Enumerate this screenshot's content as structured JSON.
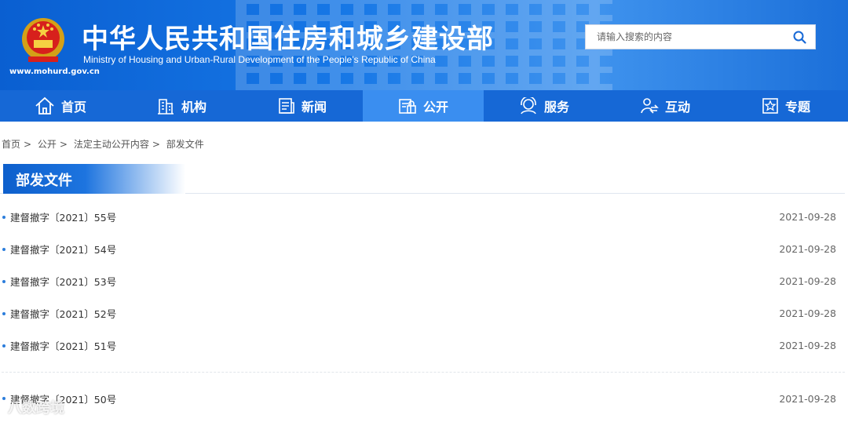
{
  "header": {
    "title_cn": "中华人民共和国住房和城乡建设部",
    "title_en": "Ministry of Housing and Urban-Rural Development of the People’s Republic of China",
    "url": "www.mohurd.gov.cn",
    "search_placeholder": "请输入搜索的内容"
  },
  "nav": {
    "items": [
      {
        "label": "首页",
        "icon": "home-icon"
      },
      {
        "label": "机构",
        "icon": "building-icon"
      },
      {
        "label": "新闻",
        "icon": "news-icon"
      },
      {
        "label": "公开",
        "icon": "disclosure-icon"
      },
      {
        "label": "服务",
        "icon": "service-icon"
      },
      {
        "label": "互动",
        "icon": "interaction-icon"
      },
      {
        "label": "专题",
        "icon": "star-icon"
      }
    ],
    "active": "公开"
  },
  "breadcrumb": {
    "items": [
      "首页",
      "公开",
      "法定主动公开内容",
      "部发文件"
    ],
    "separator": ">"
  },
  "section": {
    "title": "部发文件"
  },
  "list": {
    "items": [
      {
        "title": "建督撤字〔2021〕55号",
        "date": "2021-09-28"
      },
      {
        "title": "建督撤字〔2021〕54号",
        "date": "2021-09-28"
      },
      {
        "title": "建督撤字〔2021〕53号",
        "date": "2021-09-28"
      },
      {
        "title": "建督撤字〔2021〕52号",
        "date": "2021-09-28"
      },
      {
        "title": "建督撤字〔2021〕51号",
        "date": "2021-09-28"
      },
      {
        "title": "建督撤字〔2021〕50号",
        "date": "2021-09-28"
      }
    ]
  },
  "watermark": "八数跨境",
  "colors": {
    "brand": "#1668d6",
    "active_nav": "#3a8ef0",
    "bullet": "#2b7ddb"
  }
}
